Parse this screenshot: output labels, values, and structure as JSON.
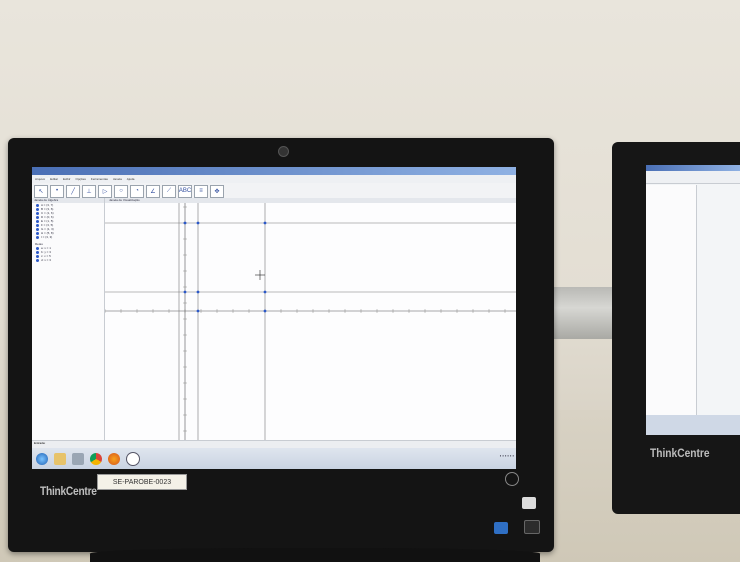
{
  "photo": {
    "monitor_brand": "ThinkCentre",
    "asset_label": "SE-PAROBE-0023",
    "second_monitor_brand": "ThinkCentre"
  },
  "app": {
    "title": "GeoGebra",
    "menus": [
      "Arquivo",
      "Editar",
      "Exibir",
      "Opções",
      "Ferramentas",
      "Janela",
      "Ajuda"
    ],
    "tools": [
      "↖",
      "•",
      "╱",
      "⊥",
      "▷",
      "○",
      "◔",
      "∠",
      "⟋",
      "ABC",
      "≡",
      "✥"
    ],
    "algebra_header": "Janela de Álgebra",
    "graphics_header": "Janela de Visualização",
    "algebra_items": [
      "A = (3, 7)",
      "B = (3, 6)",
      "C = (1, 6)",
      "D = (0, 6)",
      "E = (1, 5)",
      "F = (3, 5)",
      "G = (1, 3)",
      "H = (5, 8)",
      "I = (3, 3)"
    ],
    "free_header": "Retas",
    "line_items": [
      "a: x = 1",
      "b: y = 3",
      "c: x = 5",
      "d: x = 3"
    ],
    "input_label": "Entrada:"
  },
  "colors": {
    "accent": "#2b58c8",
    "titlebar": "#4a6fb5",
    "bezel": "#141414"
  }
}
